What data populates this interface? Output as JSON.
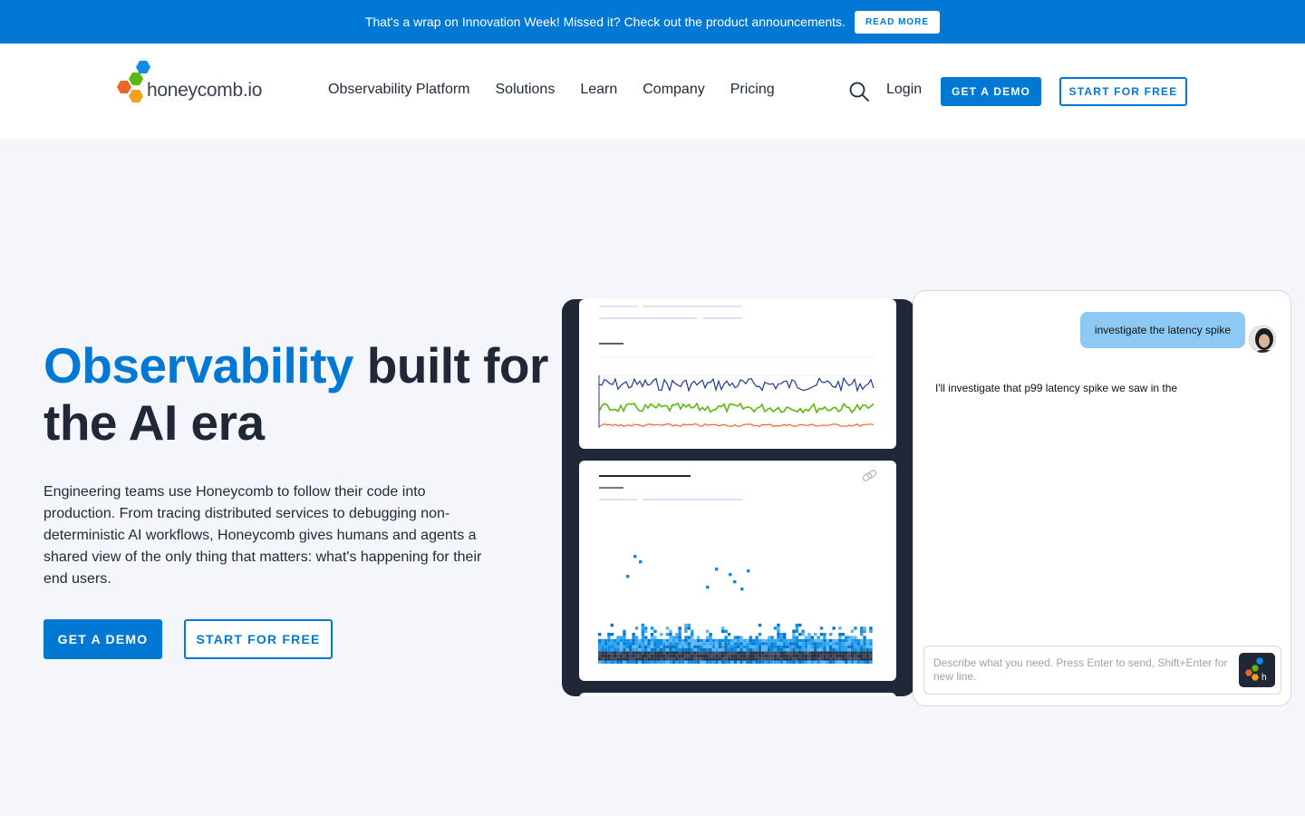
{
  "announcement": {
    "text": "That's a wrap on Innovation Week! Missed it? Check out the product announcements.",
    "button": "READ MORE"
  },
  "header": {
    "logo_text": "honeycomb.io",
    "nav": [
      "Observability Platform",
      "Solutions",
      "Learn",
      "Company",
      "Pricing"
    ],
    "search_icon": "search-icon",
    "login": "Login",
    "demo": "GET A DEMO",
    "free": "START FOR FREE"
  },
  "hero": {
    "title_accent": "Observability",
    "title_rest": " built for the AI era",
    "body": "Engineering teams use Honeycomb to follow their code into production. From tracing distributed services to debugging non-deterministic AI workflows, Honeycomb gives humans and agents a shared view of the only thing that matters: what's happening for their end users.",
    "demo": "GET A DEMO",
    "free": "START FOR FREE"
  },
  "chat": {
    "user_message": "investigate the latency spike",
    "assistant_message": "I'll investigate that p99 latency spike we saw in the",
    "input_placeholder": "Describe what you need. Press Enter to send, Shift+Enter for new line."
  },
  "colors": {
    "brand_blue": "#0278d5",
    "dark": "#202838",
    "line_blue": "#1f3a93",
    "line_green": "#5cb80f",
    "line_orange": "#e8672b",
    "heat_blue": "#0a8ee8",
    "heat_dark": "#2a3344"
  }
}
